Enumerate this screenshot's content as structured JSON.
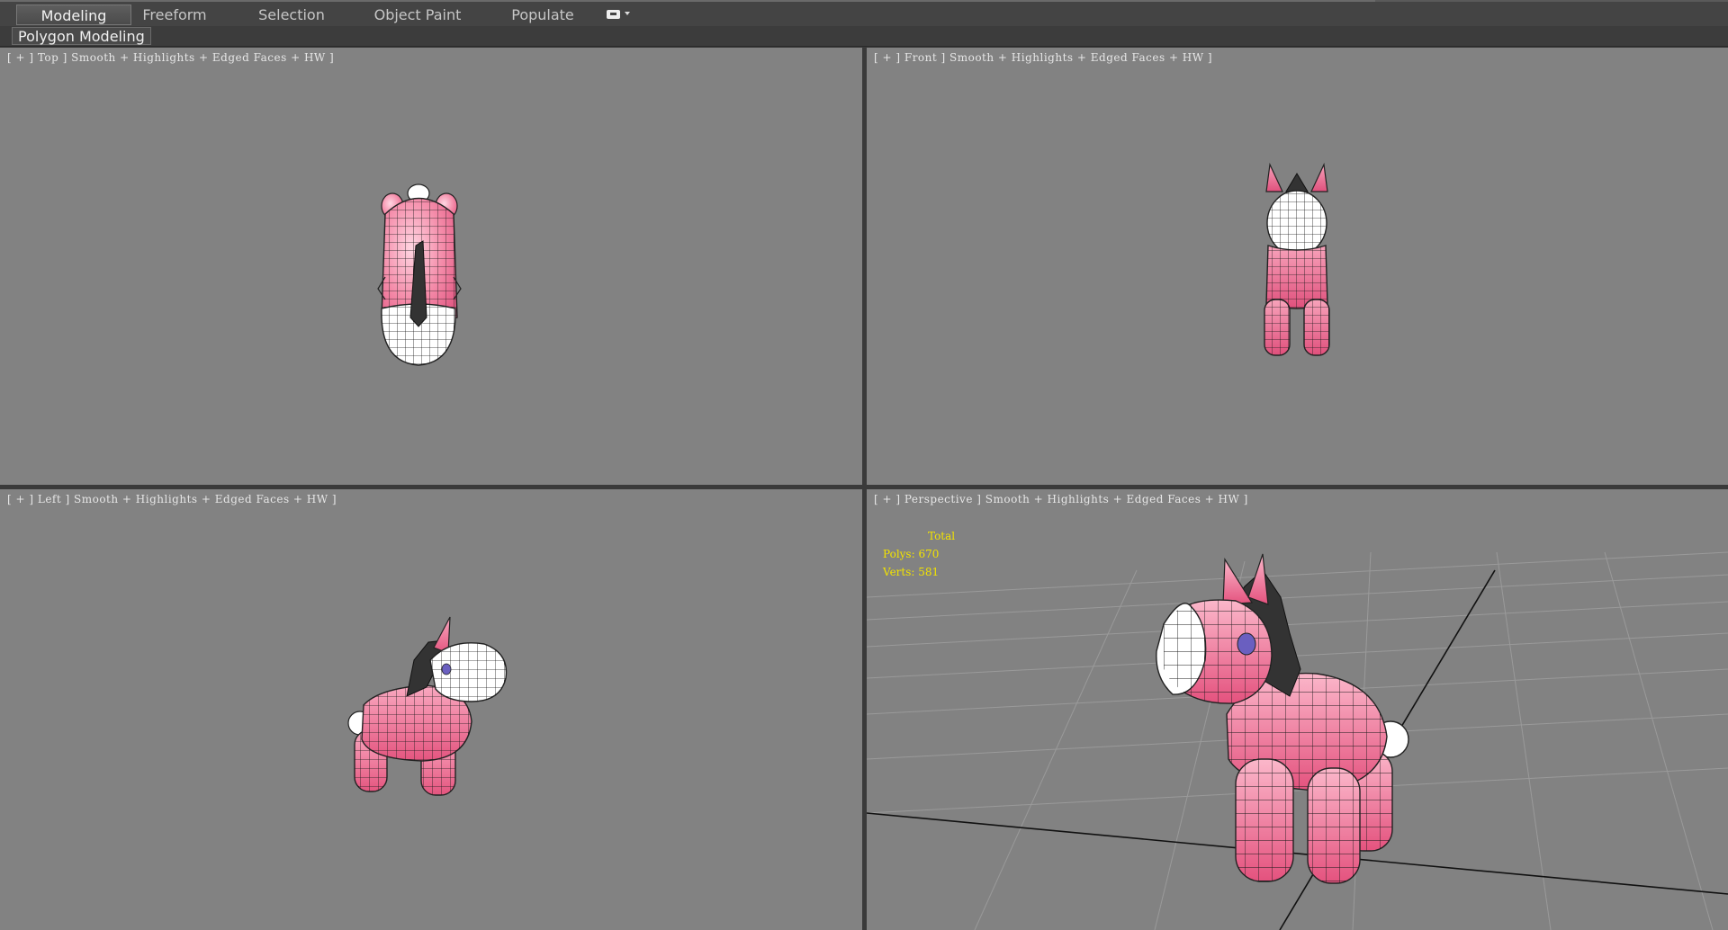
{
  "ribbon": {
    "tabs": [
      {
        "label": "Modeling",
        "active": true
      },
      {
        "label": "Freeform"
      },
      {
        "label": "Selection"
      },
      {
        "label": "Object Paint"
      },
      {
        "label": "Populate"
      }
    ],
    "panel_label": "Polygon Modeling"
  },
  "viewports": {
    "top": {
      "label": "[ + ] Top ] Smooth + Highlights + Edged Faces + HW ]"
    },
    "front": {
      "label": "[ + ] Front ] Smooth + Highlights + Edged Faces + HW ]"
    },
    "left": {
      "label": "[ + ] Left ] Smooth + Highlights + Edged Faces + HW ]"
    },
    "persp": {
      "label": "[ + ] Perspective ] Smooth + Highlights + Edged Faces + HW ]"
    }
  },
  "stats": {
    "title": "Total",
    "polys": "Polys:  670",
    "verts": "Verts:  581"
  },
  "colors": {
    "viewport_bg": "#828282",
    "model_pink": "#f07a9e",
    "model_white": "#ffffff",
    "mane": "#3a3a3a",
    "eye": "#6a5fc0",
    "stats_yellow": "#f2e300"
  }
}
